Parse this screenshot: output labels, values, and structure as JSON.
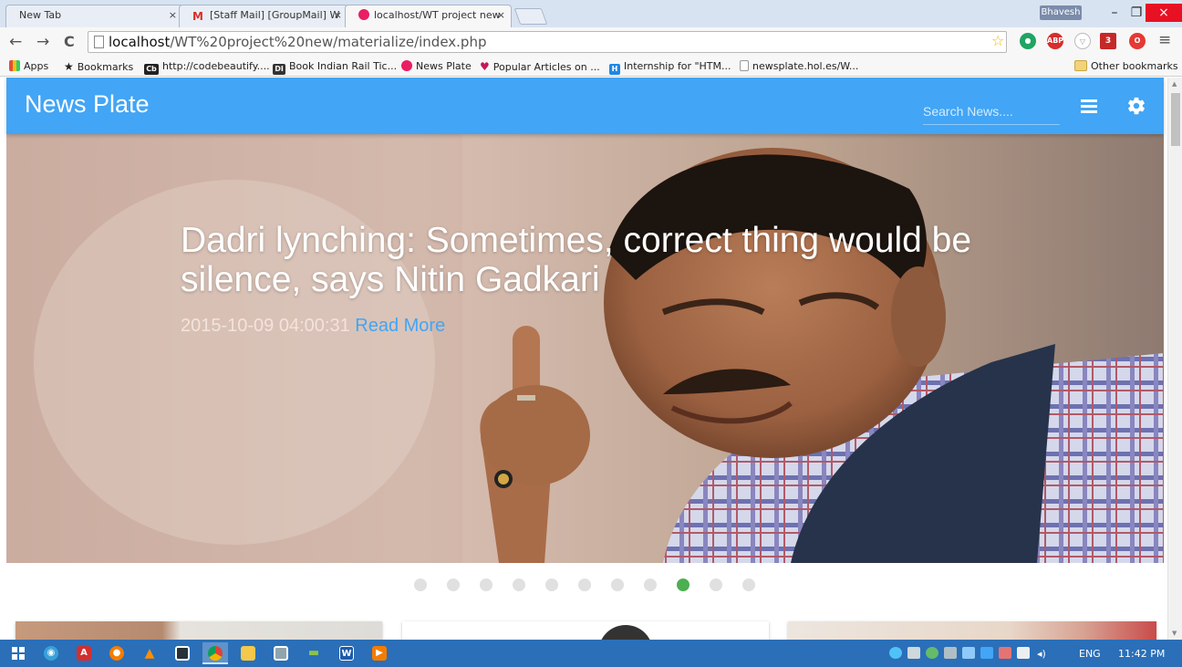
{
  "browser": {
    "tabs": [
      {
        "title": "New Tab",
        "close": "×"
      },
      {
        "title": "[Staff Mail] [GroupMail] W",
        "close": "×"
      },
      {
        "title": "localhost/WT project new",
        "close": "×"
      }
    ],
    "profile": "Bhavesh",
    "window_buttons": {
      "minimize": "–",
      "restore": "❐",
      "close": "×"
    },
    "nav": {
      "back": "←",
      "forward": "→",
      "reload": "C"
    },
    "url_host": "localhost",
    "url_path": "/WT%20project%20new/materialize/index.php",
    "extensions": {
      "abp": "ABP",
      "gmail_count": "3"
    },
    "menu": "≡",
    "bookmarks": [
      {
        "label": "Apps",
        "icon": "apps-icon"
      },
      {
        "label": "Bookmarks",
        "icon": "star-icon"
      },
      {
        "label": "http://codebeautify....",
        "icon": "cb-icon",
        "glyph": "Cb"
      },
      {
        "label": "Book Indian Rail Tic...",
        "icon": "di-icon",
        "glyph": "DI"
      },
      {
        "label": "News Plate",
        "icon": "newsplate-icon"
      },
      {
        "label": "Popular Articles on ...",
        "icon": "heart-icon"
      },
      {
        "label": "Internship for \"HTM...",
        "icon": "hi-icon",
        "glyph": "H"
      },
      {
        "label": "newsplate.hol.es/W...",
        "icon": "page-icon"
      }
    ],
    "other_bookmarks": "Other bookmarks"
  },
  "app": {
    "brand": "News Plate",
    "search_placeholder": "Search News....",
    "accent": "#42a5f5"
  },
  "slider": {
    "headline": "Dadri lynching: Sometimes, correct thing would be silence, says Nitin Gadkari",
    "timestamp": "2015-10-09 04:00:31",
    "read_more": "Read More",
    "total_slides": 11,
    "active_slide": 9,
    "indicator_active_color": "#4caf50"
  },
  "taskbar": {
    "language": "ENG",
    "clock": "11:42 PM",
    "apps": [
      "windows-start",
      "wifi",
      "acrobat",
      "firefox",
      "vlc",
      "app-5",
      "chrome",
      "file-explorer",
      "app-8",
      "android-studio",
      "word",
      "media"
    ]
  }
}
